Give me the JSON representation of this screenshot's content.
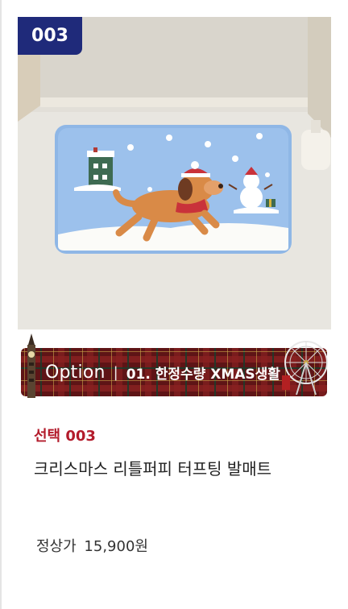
{
  "card": {
    "number_badge": "003",
    "option": {
      "word": "Option",
      "separator": "|",
      "name": "01. 한정수량 XMAS생활"
    },
    "select_label": "선택 003",
    "product_name": "크리스마스 리틀퍼피 터프팅 발매트",
    "price_label": "정상가",
    "price_value": "15,900원"
  },
  "colors": {
    "badge_bg": "#1f2a7a",
    "select_label": "#b31b2b",
    "banner_plaid": "#6b1a1a",
    "mat_blue": "#8fb7e6"
  }
}
